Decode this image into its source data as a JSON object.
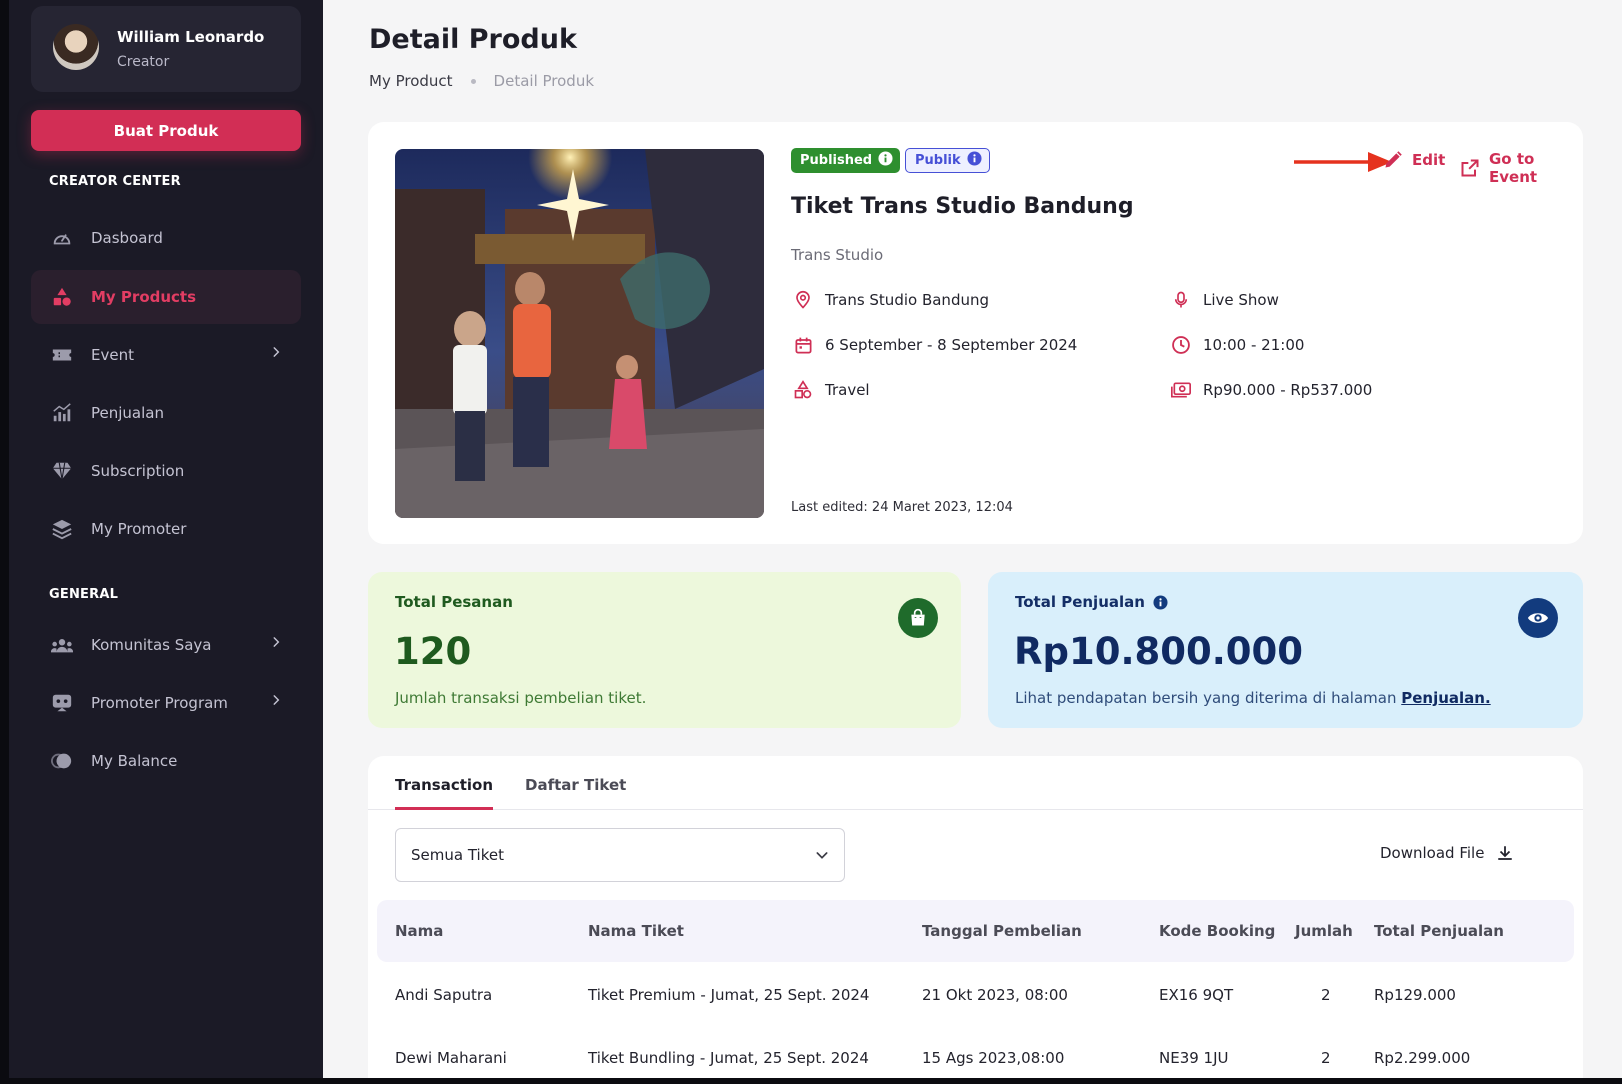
{
  "sidebar": {
    "profile": {
      "name": "William Leonardo",
      "role": "Creator"
    },
    "create_button": "Buat Produk",
    "section_creator": "CREATOR CENTER",
    "section_general": "GENERAL",
    "items": [
      {
        "label": "Dasboard",
        "icon": "gauge-icon"
      },
      {
        "label": "My Products",
        "icon": "shapes-icon",
        "active": true
      },
      {
        "label": "Event",
        "icon": "ticket-icon",
        "has_children": true
      },
      {
        "label": "Penjualan",
        "icon": "chart-icon"
      },
      {
        "label": "Subscription",
        "icon": "diamond-icon"
      },
      {
        "label": "My Promoter",
        "icon": "layers-icon"
      },
      {
        "label": "Komunitas Saya",
        "icon": "community-icon",
        "has_children": true
      },
      {
        "label": "Promoter Program",
        "icon": "promoter-icon",
        "has_children": true
      },
      {
        "label": "My Balance",
        "icon": "balance-icon"
      }
    ]
  },
  "header": {
    "title": "Detail Produk",
    "breadcrumb": [
      "My Product",
      "Detail Produk"
    ]
  },
  "product": {
    "status_badge": "Published",
    "visibility_badge": "Publik",
    "name": "Tiket Trans Studio Bandung",
    "organizer": "Trans Studio",
    "location": "Trans Studio Bandung",
    "date": "6 September - 8 September 2024",
    "category": "Travel",
    "type": "Live Show",
    "time": "10:00 - 21:00",
    "price_range": "Rp90.000 - Rp537.000",
    "last_edited": "Last edited: 24 Maret 2023, 12:04",
    "edit_label": "Edit",
    "go_to_event_label": "Go to Event"
  },
  "stats": {
    "orders": {
      "label": "Total Pesanan",
      "value": "120",
      "desc": "Jumlah transaksi pembelian tiket."
    },
    "sales": {
      "label": "Total Penjualan",
      "value": "Rp10.800.000",
      "desc": "Lihat pendapatan bersih yang diterima di halaman ",
      "link": "Penjualan."
    }
  },
  "tabs": [
    "Transaction",
    "Daftar Tiket"
  ],
  "filter": {
    "selected": "Semua Tiket"
  },
  "download_label": "Download File",
  "table": {
    "columns": [
      "Nama",
      "Nama Tiket",
      "Tanggal Pembelian",
      "Kode Booking",
      "Jumlah",
      "Total Penjualan"
    ],
    "rows": [
      [
        "Andi Saputra",
        "Tiket Premium - Jumat, 25 Sept. 2024",
        "21 Okt 2023, 08:00",
        "EX16 9QT",
        "2",
        "Rp129.000"
      ],
      [
        "Dewi Maharani",
        "Tiket Bundling - Jumat, 25 Sept. 2024",
        "15 Ags 2023,08:00",
        "NE39 1JU",
        "2",
        "Rp2.299.000"
      ]
    ]
  },
  "colors": {
    "accent": "#d22e55",
    "sidebar_bg": "#1b1a26",
    "published": "#2e8f2f",
    "publik": "#4650d6"
  }
}
